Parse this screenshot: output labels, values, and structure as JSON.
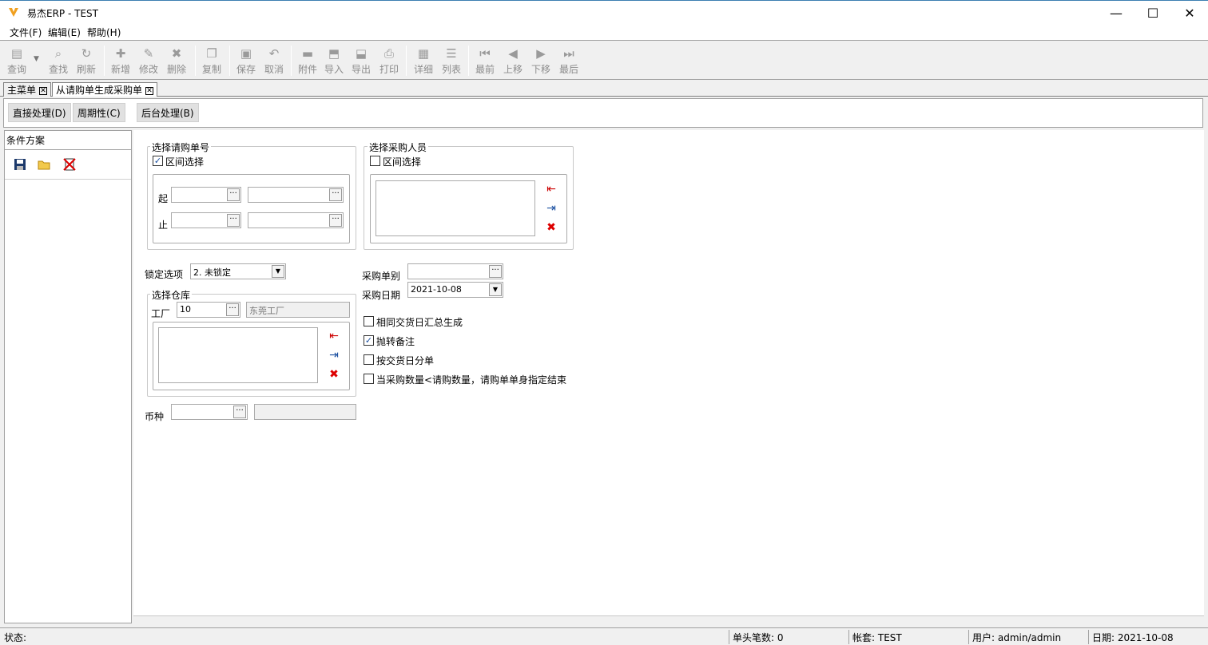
{
  "window": {
    "title": "易杰ERP - TEST",
    "minimize": "—",
    "maximize": "☐",
    "close": "✕"
  },
  "menu": [
    "文件(F)",
    "编辑(E)",
    "帮助(H)"
  ],
  "toolbar": [
    {
      "label": "查询",
      "icon": "query-icon",
      "glyph": "▤"
    },
    {
      "label": "查找",
      "icon": "find-icon",
      "glyph": "⌕"
    },
    {
      "label": "刷新",
      "icon": "refresh-icon",
      "glyph": "↻"
    },
    {
      "label": "新增",
      "icon": "add-icon",
      "glyph": "✚"
    },
    {
      "label": "修改",
      "icon": "edit-icon",
      "glyph": "✎"
    },
    {
      "label": "删除",
      "icon": "delete-icon",
      "glyph": "✖"
    },
    {
      "label": "复制",
      "icon": "copy-icon",
      "glyph": "❐"
    },
    {
      "label": "保存",
      "icon": "save-icon",
      "glyph": "▣"
    },
    {
      "label": "取消",
      "icon": "undo-icon",
      "glyph": "↶"
    },
    {
      "label": "附件",
      "icon": "attach-icon",
      "glyph": "▬"
    },
    {
      "label": "导入",
      "icon": "import-icon",
      "glyph": "⬒"
    },
    {
      "label": "导出",
      "icon": "export-icon",
      "glyph": "⬓"
    },
    {
      "label": "打印",
      "icon": "print-icon",
      "glyph": "⎙"
    },
    {
      "label": "详细",
      "icon": "detail-icon",
      "glyph": "▦"
    },
    {
      "label": "列表",
      "icon": "list-icon",
      "glyph": "☰"
    },
    {
      "label": "最前",
      "icon": "first-icon",
      "glyph": "⏮"
    },
    {
      "label": "上移",
      "icon": "prev-icon",
      "glyph": "◀"
    },
    {
      "label": "下移",
      "icon": "next-icon",
      "glyph": "▶"
    },
    {
      "label": "最后",
      "icon": "last-icon",
      "glyph": "⏭"
    }
  ],
  "tabs": [
    "主菜单",
    "从请购单生成采购单"
  ],
  "actions": [
    "直接处理(D)",
    "周期性(C)",
    "后台处理(B)"
  ],
  "left_panel": {
    "header": "条件方案"
  },
  "form": {
    "req_group_label": "选择请购单号",
    "req_range_label": "区间选择",
    "req_range_checked": true,
    "start_label": "起",
    "end_label": "止",
    "buyer_group_label": "选择采购人员",
    "buyer_range_label": "区间选择",
    "buyer_range_checked": false,
    "lock_label": "锁定选项",
    "lock_value": "2. 未锁定",
    "warehouse_group_label": "选择仓库",
    "factory_label": "工厂",
    "factory_code": "10",
    "factory_name": "东莞工厂",
    "currency_label": "币种",
    "po_type_label": "采购单别",
    "po_type_value": "",
    "po_date_label": "采购日期",
    "po_date_value": "2021-10-08",
    "options": [
      {
        "label": "相同交货日汇总生成",
        "checked": false
      },
      {
        "label": "抛转备注",
        "checked": true
      },
      {
        "label": "按交货日分单",
        "checked": false
      },
      {
        "label": "当采购数量<请购数量，请购单单身指定结束",
        "checked": false
      }
    ]
  },
  "status": {
    "state": "状态:",
    "count": "单头笔数: 0",
    "account": "帐套: TEST",
    "user": "用户: admin/admin",
    "date": "日期: 2021-10-08"
  }
}
